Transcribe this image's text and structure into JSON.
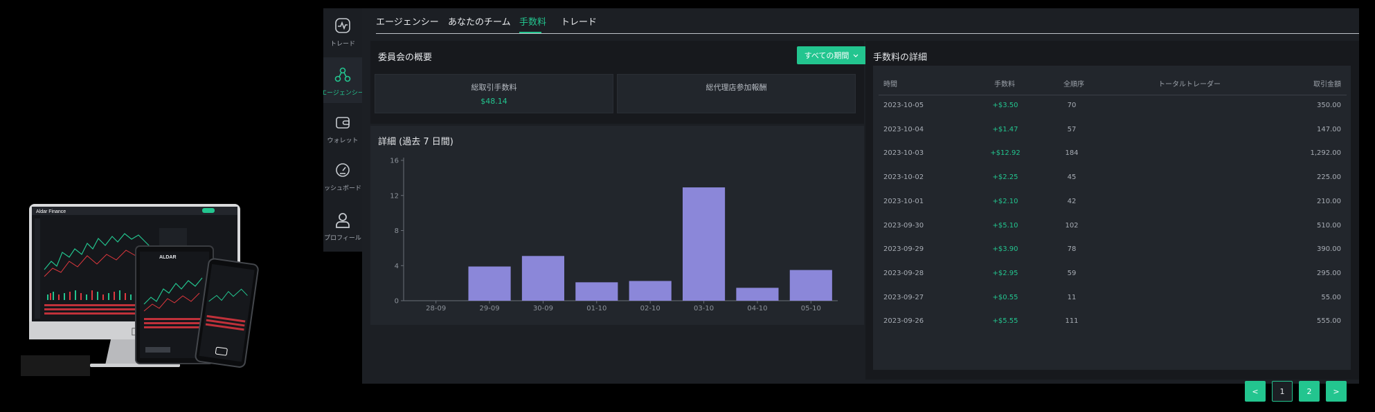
{
  "sidebar": {
    "items": [
      {
        "label": "トレード",
        "icon": "activity-icon"
      },
      {
        "label": "エージェンシー",
        "icon": "network-icon"
      },
      {
        "label": "ウォレット",
        "icon": "wallet-icon"
      },
      {
        "label": "ッシュボード",
        "icon": "dashboard-gauge-icon"
      },
      {
        "label": "プロフィール",
        "icon": "user-icon"
      }
    ]
  },
  "tabs": [
    "エージェンシー",
    "あなたのチーム",
    "手数料",
    "トレード"
  ],
  "overview": {
    "title": "委員会の概要",
    "period_button": "すべての期間",
    "total_commission_label": "総取引手数料",
    "total_commission_value": "$48.14",
    "agent_reward_label": "総代理店参加報酬",
    "agent_reward_value": ""
  },
  "chart_title": "詳細 (過去 7 日間)",
  "chart_data": {
    "type": "bar",
    "title": "詳細 (過去 7 日間)",
    "categories": [
      "28-09",
      "29-09",
      "30-09",
      "01-10",
      "02-10",
      "03-10",
      "04-10",
      "05-10"
    ],
    "values": [
      0,
      3.9,
      5.1,
      2.1,
      2.25,
      12.92,
      1.47,
      3.5
    ],
    "ylim": [
      0,
      16
    ],
    "yticks": [
      0,
      4,
      8,
      12,
      16
    ],
    "color": "#8b87d9"
  },
  "details": {
    "title": "手数料の詳細",
    "columns": [
      "時間",
      "手数料",
      "全順序",
      "トータルトレーダー",
      "取引金額"
    ],
    "rows": [
      {
        "date": "2023-10-05",
        "fee": "+$3.50",
        "orders": "70",
        "traders": "",
        "amount": "350.00"
      },
      {
        "date": "2023-10-04",
        "fee": "+$1.47",
        "orders": "57",
        "traders": "",
        "amount": "147.00"
      },
      {
        "date": "2023-10-03",
        "fee": "+$12.92",
        "orders": "184",
        "traders": "",
        "amount": "1,292.00"
      },
      {
        "date": "2023-10-02",
        "fee": "+$2.25",
        "orders": "45",
        "traders": "",
        "amount": "225.00"
      },
      {
        "date": "2023-10-01",
        "fee": "+$2.10",
        "orders": "42",
        "traders": "",
        "amount": "210.00"
      },
      {
        "date": "2023-09-30",
        "fee": "+$5.10",
        "orders": "102",
        "traders": "",
        "amount": "510.00"
      },
      {
        "date": "2023-09-29",
        "fee": "+$3.90",
        "orders": "78",
        "traders": "",
        "amount": "390.00"
      },
      {
        "date": "2023-09-28",
        "fee": "+$2.95",
        "orders": "59",
        "traders": "",
        "amount": "295.00"
      },
      {
        "date": "2023-09-27",
        "fee": "+$0.55",
        "orders": "11",
        "traders": "",
        "amount": "55.00"
      },
      {
        "date": "2023-09-26",
        "fee": "+$5.55",
        "orders": "111",
        "traders": "",
        "amount": "555.00"
      }
    ]
  },
  "pagination": {
    "prev": "<",
    "pages": [
      "1",
      "2"
    ],
    "next": ">"
  },
  "mockup": {
    "app_title": "Aldar Finance",
    "tablet_logo": "ALDAR"
  },
  "colors": {
    "accent": "#23c58f",
    "bar": "#8b87d9",
    "panel": "#1c1f24",
    "card": "#22262c"
  }
}
